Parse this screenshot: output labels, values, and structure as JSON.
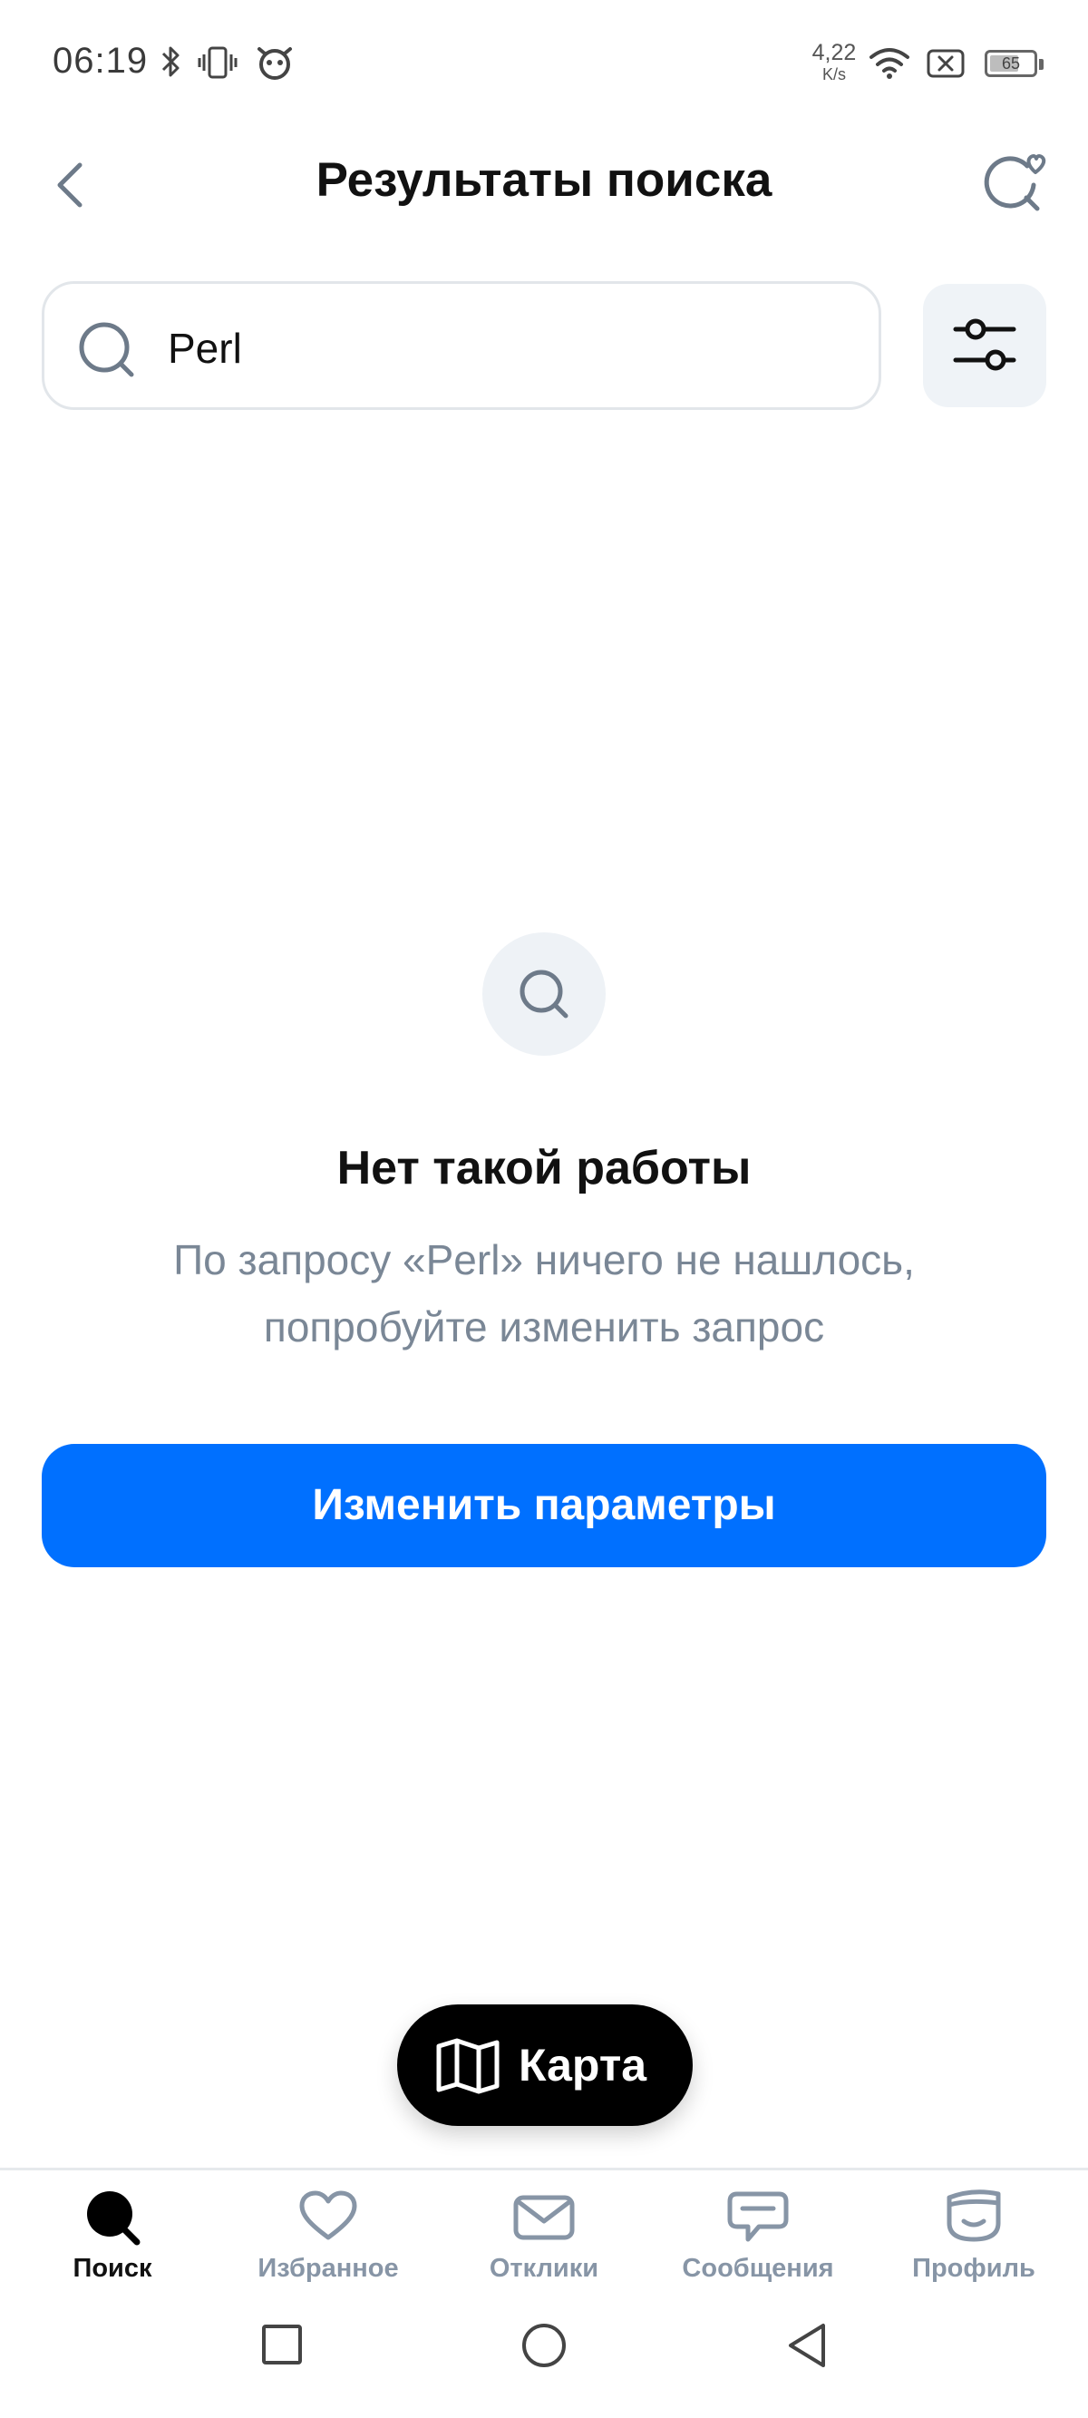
{
  "status_bar": {
    "time": "06:19",
    "net_speed_value": "4,22",
    "net_speed_unit": "K/s",
    "battery_level": "65"
  },
  "header": {
    "title": "Результаты поиска"
  },
  "search": {
    "value": "Perl",
    "placeholder": ""
  },
  "empty_state": {
    "title": "Нет такой работы",
    "description_line1": "По запросу «Perl» ничего не нашлось,",
    "description_line2": "попробуйте изменить запрос"
  },
  "actions": {
    "change_params_label": "Изменить параметры",
    "map_label": "Карта"
  },
  "bottom_nav": {
    "items": [
      {
        "label": "Поиск",
        "icon": "search-icon",
        "active": true
      },
      {
        "label": "Избранное",
        "icon": "heart-icon",
        "active": false
      },
      {
        "label": "Отклики",
        "icon": "envelope-icon",
        "active": false
      },
      {
        "label": "Сообщения",
        "icon": "chat-icon",
        "active": false
      },
      {
        "label": "Профиль",
        "icon": "profile-icon",
        "active": false
      }
    ]
  },
  "colors": {
    "primary": "#0070ff",
    "muted_text": "#7a8796",
    "icon_inactive": "#8795a6",
    "surface": "#eff3f7"
  }
}
